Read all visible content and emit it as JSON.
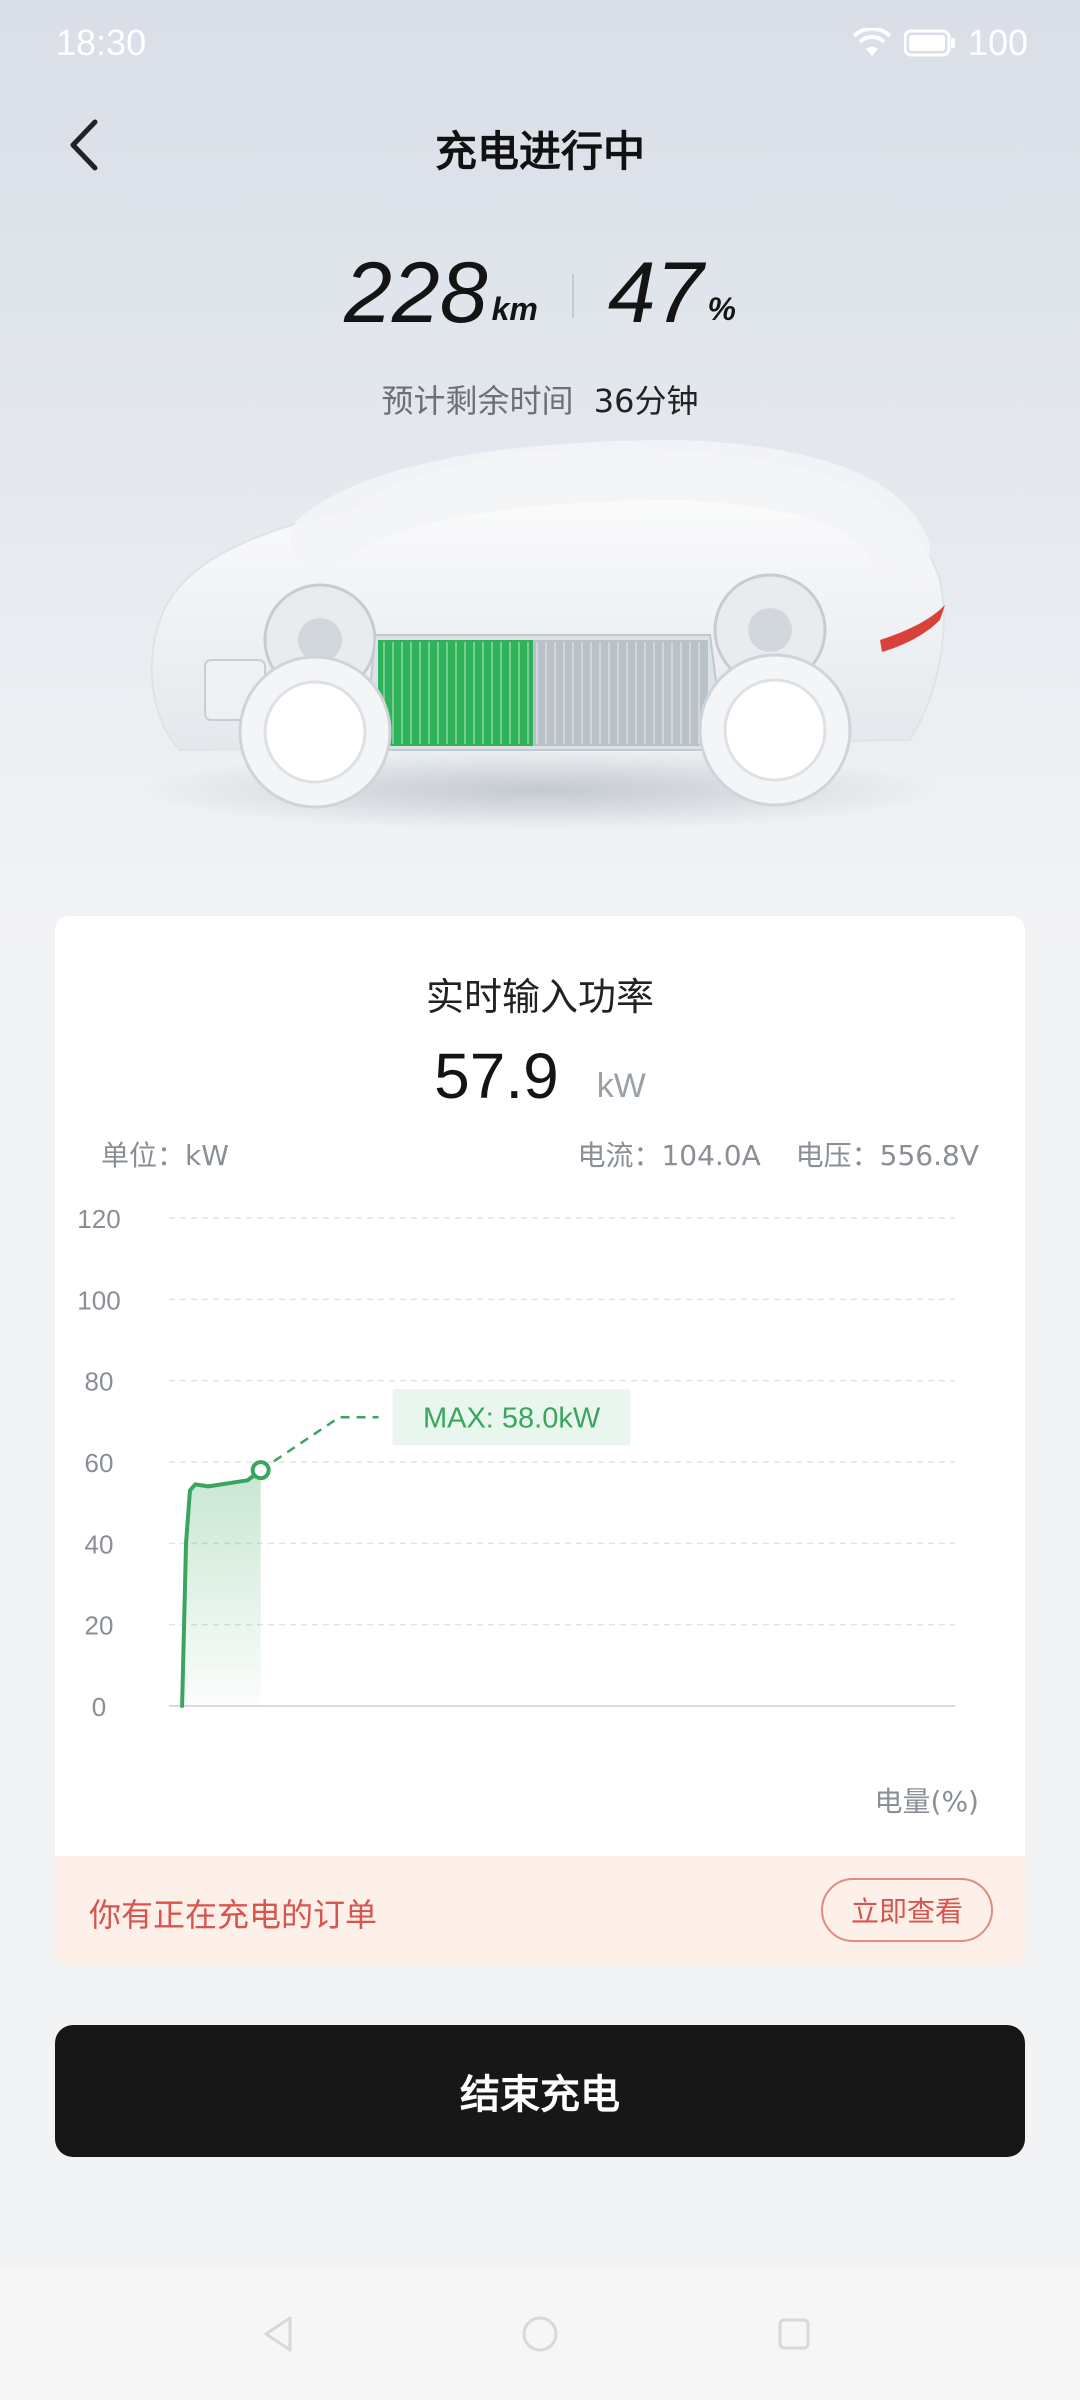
{
  "status_bar": {
    "time": "18:30",
    "battery": "100"
  },
  "header": {
    "title": "充电进行中"
  },
  "stats": {
    "range_value": "228",
    "range_unit": "km",
    "soc_value": "47",
    "soc_unit": "%"
  },
  "eta": {
    "label": "预计剩余时间",
    "value": "36分钟"
  },
  "battery_visual": {
    "charged_fraction": 0.47,
    "charged_color": "#2fb35a",
    "empty_color": "#b9c2c9"
  },
  "power_card": {
    "title": "实时输入功率",
    "value": "57.9",
    "unit": "kW",
    "unit_label": "单位：kW",
    "current": "电流：104.0A",
    "voltage": "电压：556.8V",
    "x_axis_name": "电量(%)"
  },
  "chart_data": {
    "type": "line",
    "x": [
      41,
      41.3,
      41.6,
      42,
      43,
      44,
      45,
      46,
      47
    ],
    "series": [
      {
        "values": [
          0,
          40,
          53,
          54.5,
          54,
          54.5,
          55,
          55.5,
          58
        ],
        "color": "#3aa55f"
      }
    ],
    "projection": {
      "x": [
        47,
        53,
        56
      ],
      "values": [
        58,
        71,
        71
      ]
    },
    "current_point": {
      "x": 47,
      "y": 58
    },
    "annotation": "MAX: 58.0kW",
    "xlim": [
      40,
      100
    ],
    "ylim": [
      0,
      120
    ],
    "x_ticks": [
      "40",
      "50",
      "60",
      "70",
      "80",
      "90",
      "100"
    ],
    "y_ticks": [
      "0",
      "20",
      "40",
      "60",
      "80",
      "100",
      "120"
    ],
    "grid": true
  },
  "order_banner": {
    "text": "你有正在充电的订单",
    "button": "立即查看"
  },
  "end_button": {
    "label": "结束充电"
  },
  "colors": {
    "accent_green": "#3aa55f",
    "danger_red": "#d9534f",
    "primary_button": "#171717"
  }
}
